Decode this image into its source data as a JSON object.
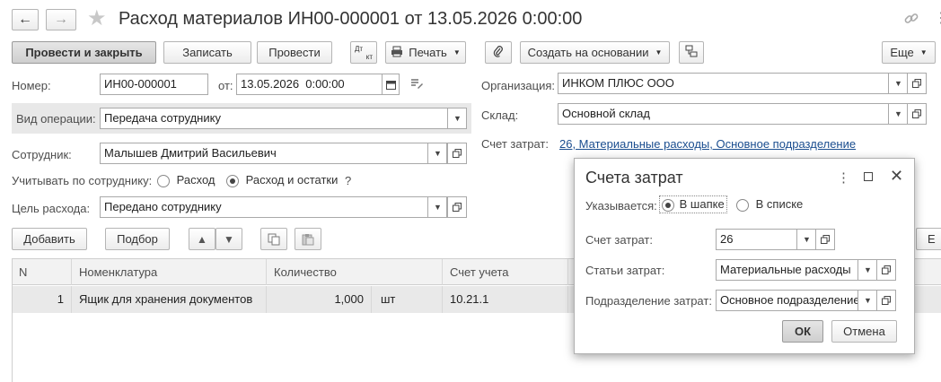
{
  "header": {
    "title": "Расход материалов ИН00-000001 от 13.05.2026 0:00:00"
  },
  "toolbar": {
    "post_close": "Провести и закрыть",
    "save": "Записать",
    "post": "Провести",
    "dtkt_top": "Дт",
    "dtkt_bottom": "кт",
    "print": "Печать",
    "create_based": "Создать на основании",
    "more": "Еще"
  },
  "form": {
    "number_label": "Номер:",
    "number_value": "ИН00-000001",
    "date_label": "от:",
    "date_value": "13.05.2026  0:00:00",
    "org_label": "Организация:",
    "org_value": "ИНКОМ ПЛЮС ООО",
    "optype_label": "Вид операции:",
    "optype_value": "Передача сотруднику",
    "warehouse_label": "Склад:",
    "warehouse_value": "Основной склад",
    "cost_account_label": "Счет затрат:",
    "cost_account_link": "26, Материальные расходы, Основное подразделение",
    "employee_label": "Сотрудник:",
    "employee_value": "Малышев Дмитрий Васильевич",
    "account_by_label": "Учитывать по сотруднику:",
    "radio_expense": "Расход",
    "radio_expense_rest": "Расход и остатки",
    "help_mark": "?",
    "purpose_label": "Цель расхода:",
    "purpose_value": "Передано сотруднику"
  },
  "table_toolbar": {
    "add": "Добавить",
    "pick": "Подбор",
    "partial_right": "Е"
  },
  "table": {
    "columns": [
      "N",
      "Номенклатура",
      "Количество",
      "Счет учета"
    ],
    "rows": [
      {
        "n": "1",
        "item": "Ящик для хранения документов",
        "qty": "1,000",
        "unit": "шт",
        "account": "10.21.1"
      }
    ]
  },
  "dialog": {
    "title": "Счета затрат",
    "specified_label": "Указывается:",
    "radio_header": "В шапке",
    "radio_list": "В списке",
    "cost_account_label": "Счет затрат:",
    "cost_account_value": "26",
    "cost_items_label": "Статьи затрат:",
    "cost_items_value": "Материальные расходы",
    "division_label": "Подразделение затрат:",
    "division_value": "Основное подразделение",
    "ok": "ОК",
    "cancel": "Отмена"
  },
  "colors": {
    "link": "#1a4d8f",
    "primary_button_bg": "#d6d6d6",
    "grid_header_bg": "#f2f2f2",
    "selected_row_bg": "#e9e9e9"
  }
}
